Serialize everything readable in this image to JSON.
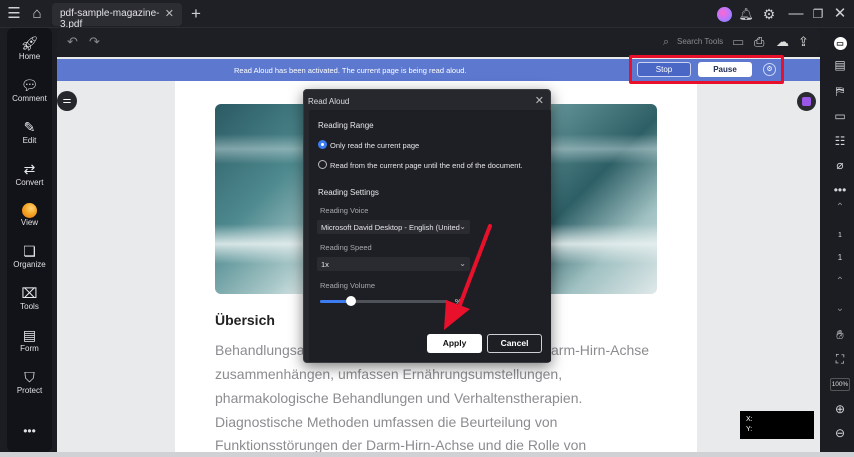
{
  "tab": {
    "title": "pdf-sample-magazine-3.pdf"
  },
  "sidebar": {
    "items": [
      {
        "label": "Home",
        "icon": "rocket-icon"
      },
      {
        "label": "Comment",
        "icon": "comment-icon"
      },
      {
        "label": "Edit",
        "icon": "edit-icon"
      },
      {
        "label": "Convert",
        "icon": "convert-icon"
      },
      {
        "label": "View",
        "icon": "view-icon"
      },
      {
        "label": "Organize",
        "icon": "organize-icon"
      },
      {
        "label": "Tools",
        "icon": "tools-icon"
      },
      {
        "label": "Form",
        "icon": "form-icon"
      },
      {
        "label": "Protect",
        "icon": "protect-icon"
      }
    ]
  },
  "toolbar": {
    "search_label": "Search Tools"
  },
  "banner": {
    "message": "Read Aloud has been activated. The current page is being read aloud.",
    "stop_label": "Stop",
    "pause_label": "Pause"
  },
  "dialog": {
    "title": "Read Aloud",
    "reading_range_heading": "Reading Range",
    "options": [
      {
        "label": "Only read the current page",
        "selected": true
      },
      {
        "label": "Read from the current page until the end of the document.",
        "selected": false
      }
    ],
    "reading_settings_heading": "Reading Settings",
    "voice_label": "Reading Voice",
    "voice_value": "Microsoft David Desktop - English (United",
    "speed_label": "Reading Speed",
    "speed_value": "1x",
    "volume_label": "Reading Volume",
    "volume_value": 0.24,
    "volume_text": "%",
    "apply_label": "Apply",
    "cancel_label": "Cancel"
  },
  "document": {
    "heading": "Übersich",
    "lines": [
      "Behandlungsa",
      "zusammenhängen, umfassen Ernährungsumstellungen,",
      "pharmakologische Behandlungen und Verhaltenstherapien.",
      "Diagnostische Methoden umfassen die Beurteilung von",
      "Funktionsstörungen der Darm-Hirn-Achse und die Rolle von"
    ],
    "line1_tail": "arm-Hirn-Achse"
  },
  "right_panel": {
    "page_number": "1",
    "zoom": "100%"
  },
  "coords": {
    "x_label": "X:",
    "y_label": "Y:"
  },
  "colors": {
    "banner": "#5c78cf",
    "accent": "#3d7bf0",
    "highlight": "#e8102b"
  }
}
